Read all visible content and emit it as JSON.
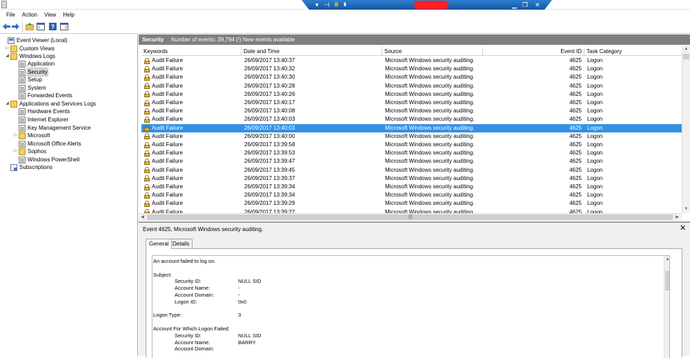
{
  "menubar": {
    "items": [
      "File",
      "Action",
      "View",
      "Help"
    ]
  },
  "rdp": {
    "glyphs": [
      "▾",
      "⊣",
      "🔒",
      "▮"
    ],
    "controls": [
      "▁",
      "❐",
      "✕"
    ]
  },
  "tree": [
    {
      "label": "Event Viewer (Local)",
      "icon": "event-viewer-icon",
      "level": 0,
      "expander": ""
    },
    {
      "label": "Custom Views",
      "icon": "folder-icon",
      "level": 1,
      "expander": "▷"
    },
    {
      "label": "Windows Logs",
      "icon": "folder-icon",
      "level": 1,
      "expander": "◢"
    },
    {
      "label": "Application",
      "icon": "log-icon",
      "level": 2,
      "expander": ""
    },
    {
      "label": "Security",
      "icon": "log-icon",
      "level": 2,
      "expander": "",
      "selected": true
    },
    {
      "label": "Setup",
      "icon": "log-icon",
      "level": 2,
      "expander": ""
    },
    {
      "label": "System",
      "icon": "log-icon",
      "level": 2,
      "expander": ""
    },
    {
      "label": "Forwarded Events",
      "icon": "log-icon",
      "level": 2,
      "expander": ""
    },
    {
      "label": "Applications and Services Logs",
      "icon": "folder-icon",
      "level": 1,
      "expander": "◢"
    },
    {
      "label": "Hardware Events",
      "icon": "log-icon",
      "level": 2,
      "expander": ""
    },
    {
      "label": "Internet Explorer",
      "icon": "log-icon",
      "level": 2,
      "expander": ""
    },
    {
      "label": "Key Management Service",
      "icon": "log-icon",
      "level": 2,
      "expander": ""
    },
    {
      "label": "Microsoft",
      "icon": "folder-icon",
      "level": 2,
      "expander": "▷"
    },
    {
      "label": "Microsoft Office Alerts",
      "icon": "log-icon",
      "level": 2,
      "expander": ""
    },
    {
      "label": "Sophos",
      "icon": "folder-icon",
      "level": 2,
      "expander": "▷"
    },
    {
      "label": "Windows PowerShell",
      "icon": "log-icon",
      "level": 2,
      "expander": ""
    },
    {
      "label": "Subscriptions",
      "icon": "subscriptions-icon",
      "level": 1,
      "expander": ""
    }
  ],
  "list_header": {
    "title": "Security",
    "info": "Number of events: 39,794 (!) New events available"
  },
  "columns": [
    "Keywords",
    "Date and Time",
    "Source",
    "Event ID",
    "Task Category"
  ],
  "events": [
    [
      "Audit Failure",
      "26/09/2017 13:40:37",
      "Microsoft Windows security auditing.",
      "4625",
      "Logon"
    ],
    [
      "Audit Failure",
      "26/09/2017 13:40:32",
      "Microsoft Windows security auditing.",
      "4625",
      "Logon"
    ],
    [
      "Audit Failure",
      "26/09/2017 13:40:30",
      "Microsoft Windows security auditing.",
      "4625",
      "Logon"
    ],
    [
      "Audit Failure",
      "26/09/2017 13:40:28",
      "Microsoft Windows security auditing.",
      "4625",
      "Logon"
    ],
    [
      "Audit Failure",
      "26/09/2017 13:40:26",
      "Microsoft Windows security auditing.",
      "4625",
      "Logon"
    ],
    [
      "Audit Failure",
      "26/09/2017 13:40:17",
      "Microsoft Windows security auditing.",
      "4625",
      "Logon"
    ],
    [
      "Audit Failure",
      "26/09/2017 13:40:08",
      "Microsoft Windows security auditing.",
      "4625",
      "Logon"
    ],
    [
      "Audit Failure",
      "26/09/2017 13:40:03",
      "Microsoft Windows security auditing.",
      "4625",
      "Logon"
    ],
    [
      "Audit Failure",
      "26/09/2017 13:40:03",
      "Microsoft Windows security auditing.",
      "4625",
      "Logon"
    ],
    [
      "Audit Failure",
      "26/09/2017 13:40:00",
      "Microsoft Windows security auditing.",
      "4625",
      "Logon"
    ],
    [
      "Audit Failure",
      "26/09/2017 13:39:58",
      "Microsoft Windows security auditing.",
      "4625",
      "Logon"
    ],
    [
      "Audit Failure",
      "26/09/2017 13:39:53",
      "Microsoft Windows security auditing.",
      "4625",
      "Logon"
    ],
    [
      "Audit Failure",
      "26/09/2017 13:39:47",
      "Microsoft Windows security auditing.",
      "4625",
      "Logon"
    ],
    [
      "Audit Failure",
      "26/09/2017 13:39:45",
      "Microsoft Windows security auditing.",
      "4625",
      "Logon"
    ],
    [
      "Audit Failure",
      "26/09/2017 13:39:37",
      "Microsoft Windows security auditing.",
      "4625",
      "Logon"
    ],
    [
      "Audit Failure",
      "26/09/2017 13:39:34",
      "Microsoft Windows security auditing.",
      "4625",
      "Logon"
    ],
    [
      "Audit Failure",
      "26/09/2017 13:39:34",
      "Microsoft Windows security auditing.",
      "4625",
      "Logon"
    ],
    [
      "Audit Failure",
      "26/09/2017 13:39:29",
      "Microsoft Windows security auditing.",
      "4625",
      "Logon"
    ],
    [
      "Audit Failure",
      "26/09/2017 13:39:27",
      "Microsoft Windows security auditing.",
      "4625",
      "Logon"
    ]
  ],
  "selected_event_index": 8,
  "detail": {
    "header": "Event 4625, Microsoft Windows security auditing.",
    "close": "✕",
    "tabs": [
      "General",
      "Details"
    ],
    "active_tab": 0,
    "lines": [
      {
        "text": "An account failed to log on."
      },
      {
        "text": ""
      },
      {
        "text": "Subject:"
      },
      {
        "label": "Security ID:",
        "value": "NULL SID"
      },
      {
        "label": "Account Name:",
        "value": "-"
      },
      {
        "label": "Account Domain:",
        "value": "-"
      },
      {
        "label": "Logon ID:",
        "value": "0x0"
      },
      {
        "text": ""
      },
      {
        "text": "Logon Type:",
        "value_inline": "3"
      },
      {
        "text": ""
      },
      {
        "text": "Account For Which Logon Failed:"
      },
      {
        "label": "Security ID:",
        "value": "NULL SID"
      },
      {
        "label": "Account Name:",
        "value": "BARRY"
      },
      {
        "label": "Account Domain:",
        "value": ""
      }
    ]
  },
  "list_hscroll_grip": "|||",
  "colors": {
    "selection": "#3391e7",
    "header_bar": "#7f7f7f",
    "rdp_bar": "#1f6bc0"
  }
}
